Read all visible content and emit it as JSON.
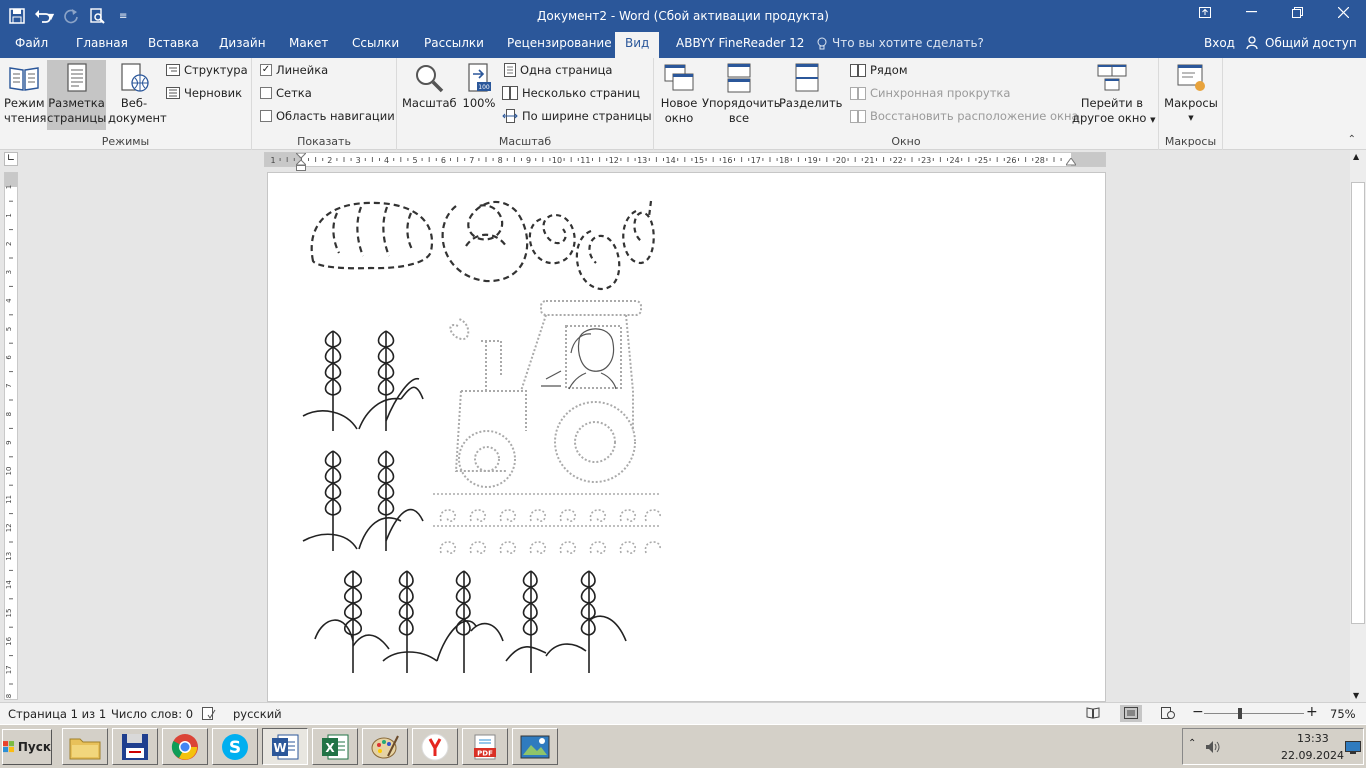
{
  "window": {
    "title": "Документ2 - Word (Сбой активации продукта)"
  },
  "tabs": [
    {
      "label": "Файл"
    },
    {
      "label": "Главная"
    },
    {
      "label": "Вставка"
    },
    {
      "label": "Дизайн"
    },
    {
      "label": "Макет"
    },
    {
      "label": "Ссылки"
    },
    {
      "label": "Рассылки"
    },
    {
      "label": "Рецензирование"
    },
    {
      "label": "Вид",
      "active": true
    },
    {
      "label": "ABBYY FineReader 12"
    }
  ],
  "tell_me": "Что вы хотите сделать?",
  "signin": "Вход",
  "share": "Общий доступ",
  "ribbon": {
    "modes": {
      "group": "Режимы",
      "read": [
        "Режим",
        "чтения"
      ],
      "layout": [
        "Разметка",
        "страницы"
      ],
      "web": [
        "Веб-",
        "документ"
      ],
      "outline": "Структура",
      "draft": "Черновик"
    },
    "show": {
      "group": "Показать",
      "ruler": {
        "label": "Линейка",
        "checked": true
      },
      "grid": {
        "label": "Сетка",
        "checked": false
      },
      "nav": {
        "label": "Область навигации",
        "checked": false
      }
    },
    "zoom": {
      "group": "Масштаб",
      "zoom": "Масштаб",
      "pct": "100%",
      "one_page": "Одна страница",
      "multi_page": "Несколько страниц",
      "page_width": "По ширине страницы"
    },
    "window": {
      "group": "Окно",
      "new": [
        "Новое",
        "окно"
      ],
      "arrange": [
        "Упорядочить",
        "все"
      ],
      "split": "Разделить",
      "side_by_side": "Рядом",
      "sync_scroll": "Синхронная прокрутка",
      "reset_pos": "Восстановить расположение окна",
      "switch": [
        "Перейти в",
        "другое окно"
      ]
    },
    "macros": {
      "group": "Макросы",
      "macros": "Макросы"
    }
  },
  "ruler": {
    "h_ticks": [
      "1",
      "1",
      "2",
      "3",
      "4",
      "5",
      "6",
      "7",
      "8",
      "9",
      "10",
      "11",
      "12",
      "13",
      "14",
      "15",
      "16",
      "17",
      "18",
      "19",
      "20",
      "21",
      "22",
      "23",
      "24",
      "25",
      "26",
      "28"
    ],
    "v_ticks": [
      "1",
      "1",
      "2",
      "3",
      "4",
      "5",
      "6",
      "7",
      "8",
      "9",
      "10",
      "11",
      "12",
      "13",
      "14",
      "15",
      "16",
      "17",
      "18"
    ]
  },
  "status": {
    "page": "Страница 1 из 1",
    "words": "Число слов: 0",
    "lang": "русский",
    "zoom_pct": "75%",
    "zoom_level": 0.75
  },
  "taskbar": {
    "start": "Пуск",
    "time": "13:33",
    "date": "22.09.2024"
  },
  "colors": {
    "brand": "#2b579a",
    "ribbon_bg": "#f3f3f3",
    "taskbar": "#d4d0c8"
  }
}
